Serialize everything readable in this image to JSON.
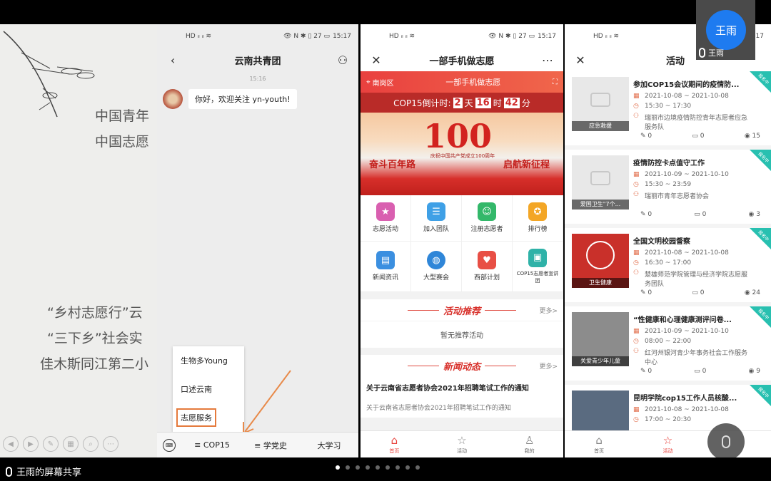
{
  "share_label": "王雨的屏幕共享",
  "video_tile": {
    "avatar_text": "王雨",
    "name": "王雨"
  },
  "slide": {
    "lines": [
      "中国青年",
      "中国志愿",
      "“乡村志愿行”云",
      "“三下乡”社会实",
      "佳木斯同江第二小"
    ]
  },
  "phone_status": {
    "time": "15:17",
    "signal": "HD ᵢₗ ᵢₗ ≋",
    "icons": "👁 N ✱ ▯ 27 ▭"
  },
  "chat": {
    "title": "云南共青团",
    "time": "15:16",
    "message": "你好，欢迎关注 yn-youth!",
    "popup_items": [
      "生物多Young",
      "口述云南",
      "志愿服务"
    ],
    "menu": [
      "≡ COP15",
      "≡ 学党史",
      "大学习"
    ]
  },
  "home": {
    "title": "一部手机做志愿",
    "location": "南岗区",
    "bar_title": "一部手机做志愿",
    "countdown": {
      "label": "COP15倒计时:",
      "days": "2",
      "day_unit": "天",
      "hours": "16",
      "hour_unit": "时",
      "minutes": "42",
      "minute_unit": "分"
    },
    "banner": {
      "left": "奋斗百年路",
      "right": "启航新征程",
      "center": "100",
      "caption": "庆祝中国共产党成立100周年"
    },
    "grid": [
      {
        "label": "志愿活动",
        "icon": "star-icon",
        "color": "#d95fb0"
      },
      {
        "label": "加入团队",
        "icon": "team-icon",
        "color": "#3fa0e6"
      },
      {
        "label": "注册志愿者",
        "icon": "person-icon",
        "color": "#33b86a"
      },
      {
        "label": "排行榜",
        "icon": "medal-icon",
        "color": "#f3a626"
      },
      {
        "label": "新闻资讯",
        "icon": "news-icon",
        "color": "#3b8fe0"
      },
      {
        "label": "大型赛会",
        "icon": "globe-icon",
        "color": "#2f86d8"
      },
      {
        "label": "西部计划",
        "icon": "heart-icon",
        "color": "#e84f45"
      },
      {
        "label": "COP15志愿者宣讲团",
        "icon": "presenter-icon",
        "color": "#2fb2a8"
      }
    ],
    "section_recommend": "活动推荐",
    "section_news": "新闻动态",
    "more": "更多>",
    "empty_text": "暂无推荐活动",
    "news_title": "关于云南省志愿者协会2021年招聘笔试工作的通知",
    "news_summary": "关于云南省志愿者协会2021年招聘笔试工作的通知",
    "tabs": [
      "首页",
      "活动",
      "我的"
    ]
  },
  "activities": {
    "title": "活动",
    "badge": "报名中",
    "items": [
      {
        "title": "参加COP15会议期间的疫情防...",
        "date": "2021-10-08 ~ 2021-10-08",
        "time": "15:30 ~ 17:30",
        "org": "瑞丽市边境疫情防控青年志愿者应急服务队",
        "caption": "应急救援",
        "likes": "0",
        "comments": "0",
        "views": "15"
      },
      {
        "title": "疫情防控卡点值守工作",
        "date": "2021-10-09 ~ 2021-10-10",
        "time": "15:30 ~ 23:59",
        "org": "瑞丽市青年志愿者协会",
        "caption": "爱国卫生\"7个...",
        "likes": "0",
        "comments": "0",
        "views": "3"
      },
      {
        "title": "全国文明校园督察",
        "date": "2021-10-08 ~ 2021-10-08",
        "time": "16:30 ~ 17:00",
        "org": "楚雄师范学院管理与经济学院志愿服务团队",
        "caption": "卫生健康",
        "likes": "0",
        "comments": "0",
        "views": "24"
      },
      {
        "title": "“性健康和心理健康测评问卷...",
        "date": "2021-10-09 ~ 2021-10-10",
        "time": "08:00 ~ 22:00",
        "org": "红河州银河青少年事务社会工作服务中心",
        "caption": "关爱青少年儿童",
        "likes": "0",
        "comments": "0",
        "views": "9"
      },
      {
        "title": "昆明学院cop15工作人员核酸...",
        "date": "2021-10-08 ~ 2021-10-08",
        "time": "17:00 ~ 20:30",
        "org": "",
        "caption": "",
        "likes": "",
        "comments": "",
        "views": ""
      }
    ],
    "tabs": [
      "首页",
      "活动"
    ]
  },
  "colors": {
    "accent_red": "#e8413b",
    "badge_teal": "#28c0b0",
    "tile_blue": "#1e7bf0"
  }
}
